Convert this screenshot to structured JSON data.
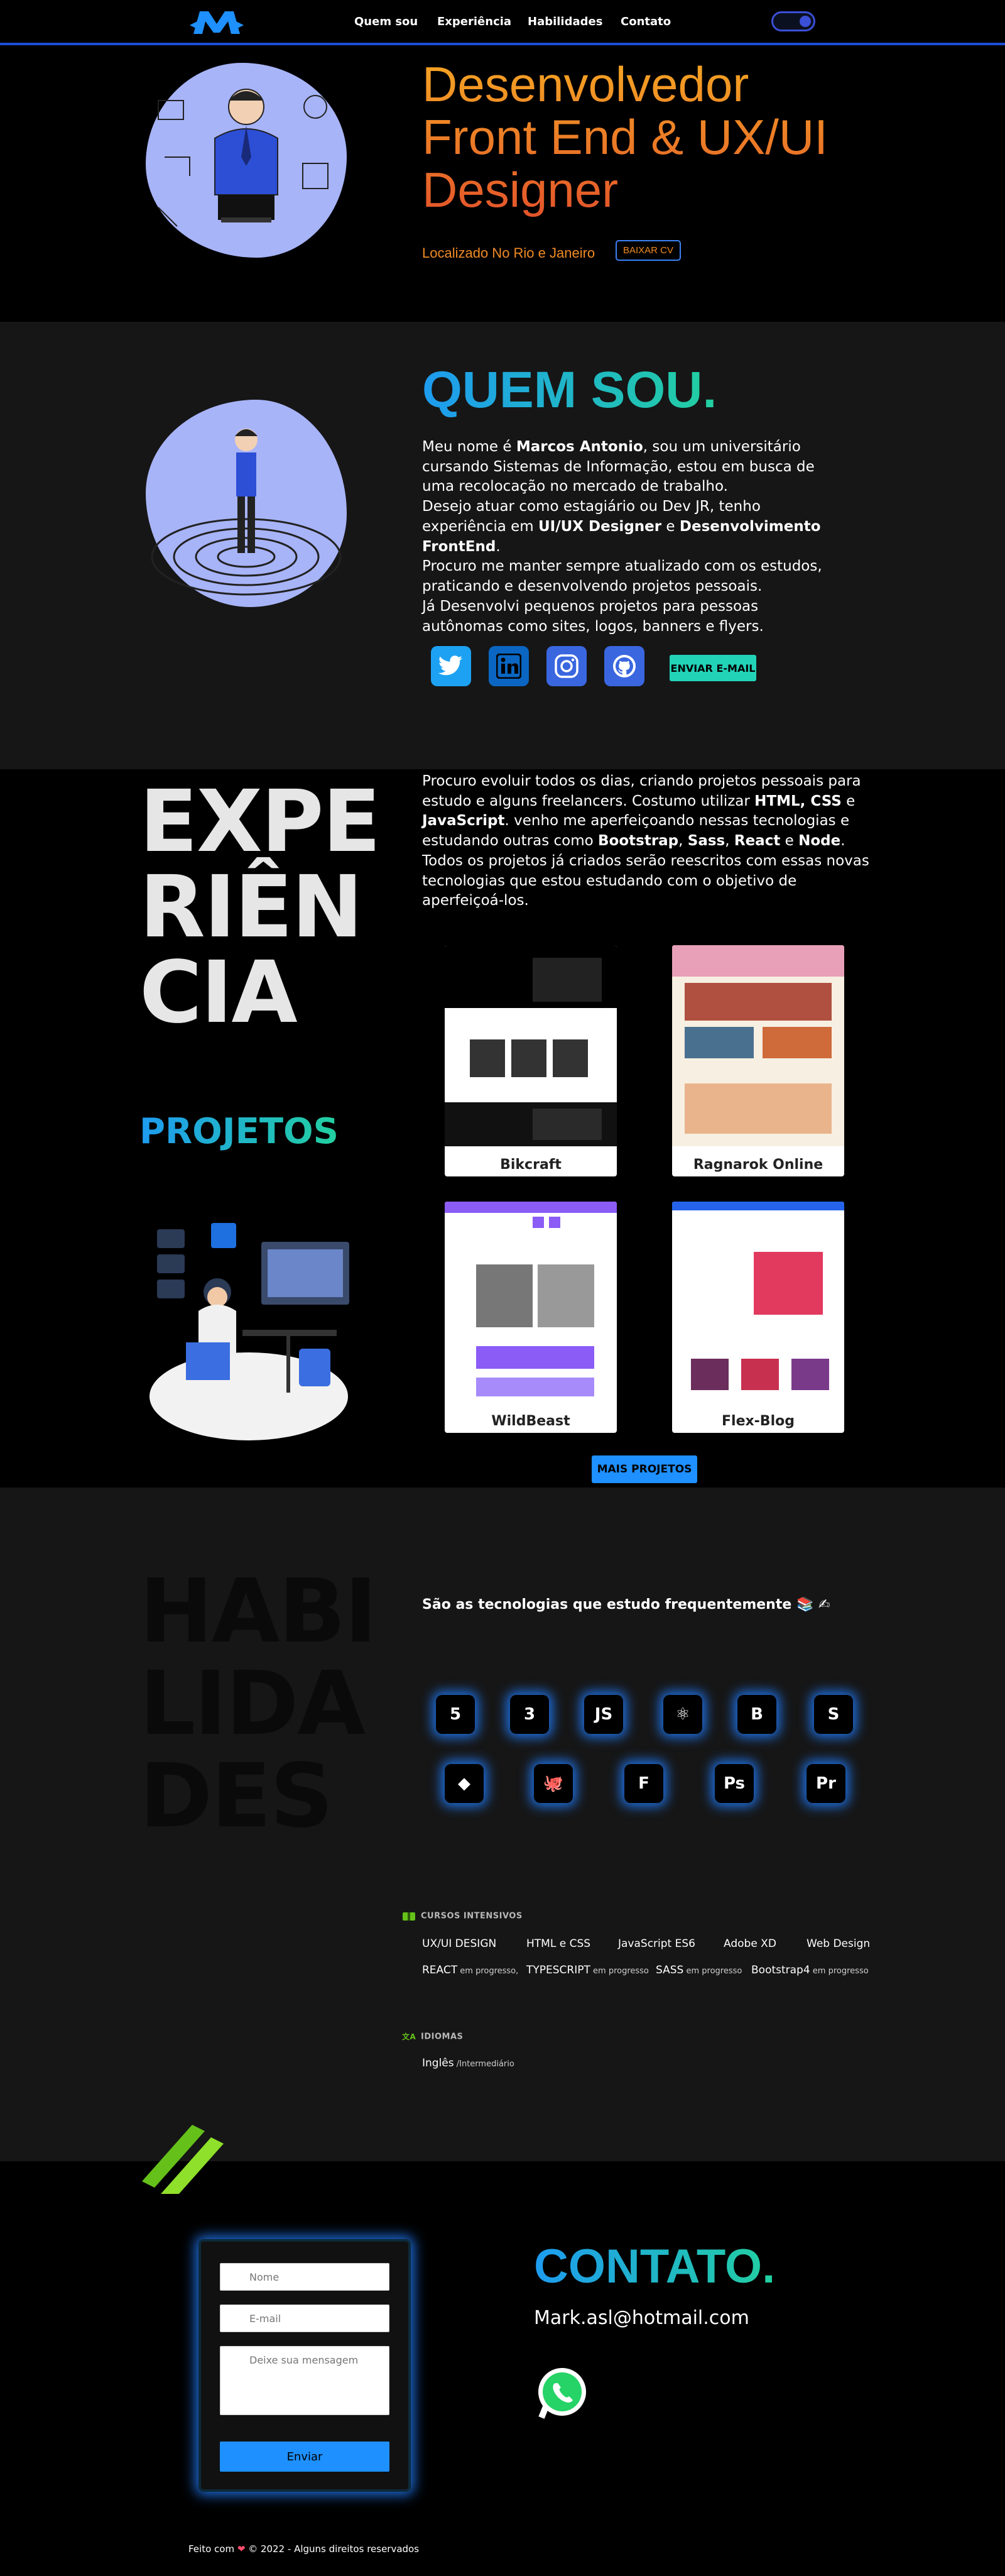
{
  "nav": {
    "links": [
      "Quem sou",
      "Experiência",
      "Habilidades",
      "Contato"
    ]
  },
  "hero": {
    "title": "Desenvolvedor Front End & UX/UI Designer",
    "location": "Localizado No Rio e Janeiro",
    "cv_button": "BAIXAR CV"
  },
  "about": {
    "title": "QUEM SOU.",
    "p1_a": "Meu nome é ",
    "p1_b": "Marcos Antonio",
    "p1_c": ", sou um universitário cursando Sistemas de Informação, estou em busca de uma recolocação no mercado de trabalho.",
    "p2_a": "Desejo atuar como estagiário ou Dev JR, tenho experiência em ",
    "p2_b": "UI/UX Designer",
    "p2_c": " e ",
    "p2_d": "Desenvolvimento FrontEnd",
    "p3": "Procuro me manter sempre atualizado com os estudos, praticando e desenvolvendo projetos pessoais.",
    "p4": "Já Desenvolvi pequenos projetos para pessoas autônomas como sites, logos, banners e flyers.",
    "email_button": "ENVIAR E-MAIL",
    "social": [
      "twitter-icon",
      "linkedin-icon",
      "instagram-icon",
      "github-icon"
    ]
  },
  "experience": {
    "title_l1": "EXPE",
    "title_l2": "RIÊN",
    "title_l3": "CIA",
    "t_a": "Procuro evoluir todos os dias, criando projetos pessoais para estudo e alguns freelancers. Costumo utilizar ",
    "t_b": "HTML, CSS",
    "t_c": " e ",
    "t_d": "JavaScript",
    "t_e": ". venho me aperfeiçoando nessas tecnologias e estudando outras como ",
    "t_f": "Bootstrap",
    "t_g": ", ",
    "t_h": "Sass",
    "t_i": ", ",
    "t_j": "React",
    "t_k": " e ",
    "t_l": "Node",
    "t_m": ". Todos os projetos já criados serão reescritos com essas novas tecnologias que estou estudando com o objetivo de aperfeiçoá-los.",
    "projects_title": "PROJETOS",
    "projects": [
      "Bikcraft",
      "Ragnarok Online",
      "WildBeast",
      "Flex-Blog"
    ],
    "more_button": "MAIS PROJETOS"
  },
  "skills": {
    "title_l1": "HABI",
    "title_l2": "LIDA",
    "title_l3": "DES",
    "lead": "São as tecnologias que estudo frequentemente 📚 ✍",
    "tech_icons": [
      "html5-icon",
      "css3-icon",
      "javascript-icon",
      "react-icon",
      "bootstrap-icon",
      "sass-icon",
      "git-icon",
      "github-icon",
      "figma-icon",
      "photoshop-icon",
      "premiere-icon"
    ],
    "tech_labels": [
      "5",
      "3",
      "JS",
      "⚛",
      "B",
      "S",
      "◆",
      "🐙",
      "F",
      "Ps",
      "Pr"
    ],
    "courses_heading": "CURSOS INTENSIVOS",
    "courses": [
      "UX/UI DESIGN",
      "HTML e CSS",
      "JavaScript ES6",
      "Adobe XD",
      "Web Design"
    ],
    "progress": [
      {
        "name": "REACT",
        "note": " em progresso,"
      },
      {
        "name": "TYPESCRIPT",
        "note": " em progresso"
      },
      {
        "name": "SASS",
        "note": " em progresso"
      },
      {
        "name": "Bootstrap4",
        "note": " em progresso"
      }
    ],
    "languages_heading": "IDIOMAS",
    "language": "Inglês",
    "language_level": " /Intermediário"
  },
  "contact": {
    "name_placeholder": "Nome",
    "email_placeholder": "E-mail",
    "message_placeholder": "Deixe sua mensagem",
    "send": "Enviar",
    "title": "CONTATO.",
    "email": "Mark.asl@hotmail.com"
  },
  "footer": {
    "a": "Feito com ",
    "heart": "❤",
    "b": " © 2022 - Alguns direitos reservados"
  }
}
